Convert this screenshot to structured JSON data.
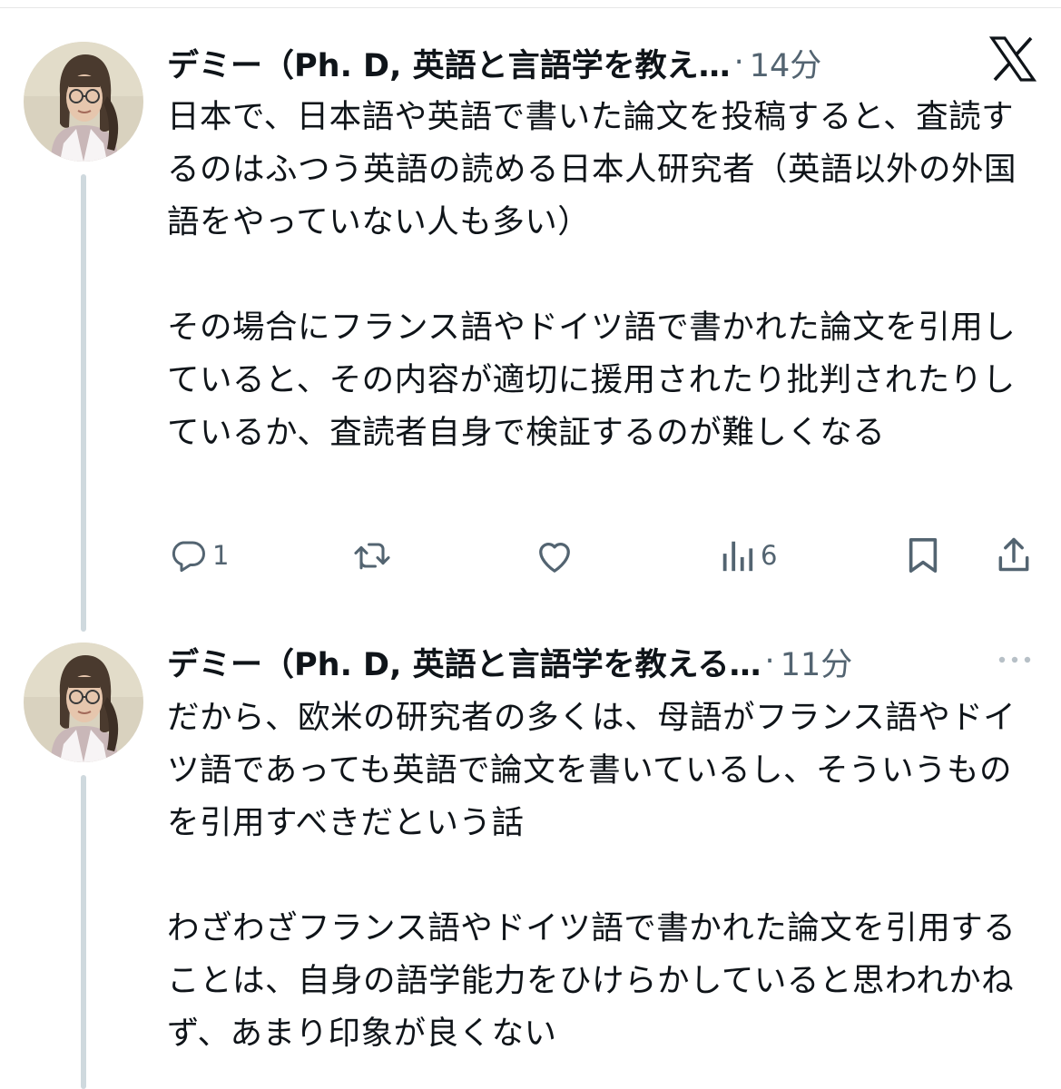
{
  "brand": {
    "logo_icon": "x-logo-icon"
  },
  "tweets": [
    {
      "author": "デミー（Ph. D, 英語と言語学を教え…",
      "separator": "·",
      "time": "14分",
      "text": "日本で、日本語や英語で書いた論文を投稿すると、査読するのはふつう英語の読める日本人研究者（英語以外の外国語をやっていない人も多い）\n\nその場合にフランス語やドイツ語で書かれた論文を引用していると、その内容が適切に援用されたり批判されたりしているか、査読者自身で検証するのが難しくなる",
      "actions": {
        "reply_icon": "reply-icon",
        "reply_count": "1",
        "repost_icon": "repost-icon",
        "like_icon": "heart-icon",
        "views_icon": "views-icon",
        "views_count": "6",
        "bookmark_icon": "bookmark-icon",
        "share_icon": "share-icon"
      }
    },
    {
      "author": "デミー（Ph. D, 英語と言語学を教える…",
      "separator": "·",
      "time": "11分",
      "more_icon": "more-icon",
      "text": "だから、欧米の研究者の多くは、母語がフランス語やドイツ語であっても英語で論文を書いているし、そういうものを引用すべきだという話\n\nわざわざフランス語やドイツ語で書かれた論文を引用することは、自身の語学能力をひけらかしていると思われかねず、あまり印象が良くない"
    }
  ],
  "colors": {
    "text": "#0f1419",
    "secondary": "#536471",
    "thread_line": "#cfd9de"
  }
}
